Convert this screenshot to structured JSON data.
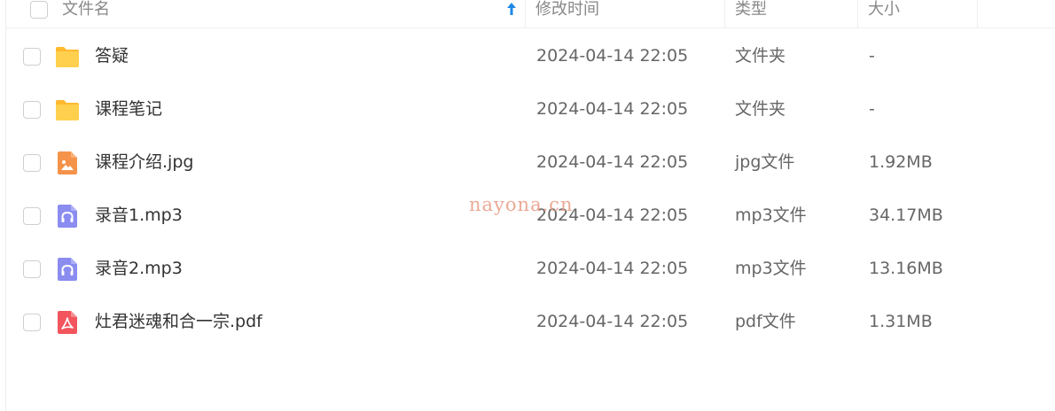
{
  "header": {
    "name": "文件名",
    "mtime": "修改时间",
    "type": "类型",
    "size": "大小",
    "sort_icon": "sort-ascending-arrow",
    "sort_color": "#1e88e5"
  },
  "files": [
    {
      "name": "答疑",
      "mtime": "2024-04-14 22:05",
      "type": "文件夹",
      "size": "-",
      "icon": "folder-icon"
    },
    {
      "name": "课程笔记",
      "mtime": "2024-04-14 22:05",
      "type": "文件夹",
      "size": "-",
      "icon": "folder-icon"
    },
    {
      "name": "课程介绍.jpg",
      "mtime": "2024-04-14 22:05",
      "type": "jpg文件",
      "size": "1.92MB",
      "icon": "image-file-icon"
    },
    {
      "name": "录音1.mp3",
      "mtime": "2024-04-14 22:05",
      "type": "mp3文件",
      "size": "34.17MB",
      "icon": "audio-file-icon"
    },
    {
      "name": "录音2.mp3",
      "mtime": "2024-04-14 22:05",
      "type": "mp3文件",
      "size": "13.16MB",
      "icon": "audio-file-icon"
    },
    {
      "name": "灶君迷魂和合一宗.pdf",
      "mtime": "2024-04-14 22:05",
      "type": "pdf文件",
      "size": "1.31MB",
      "icon": "pdf-file-icon"
    }
  ],
  "watermark": "nayona.cn",
  "colors": {
    "folder": "#ffc93c",
    "image": "#f5934a",
    "audio": "#8a8cf0",
    "pdf": "#f2555d"
  }
}
